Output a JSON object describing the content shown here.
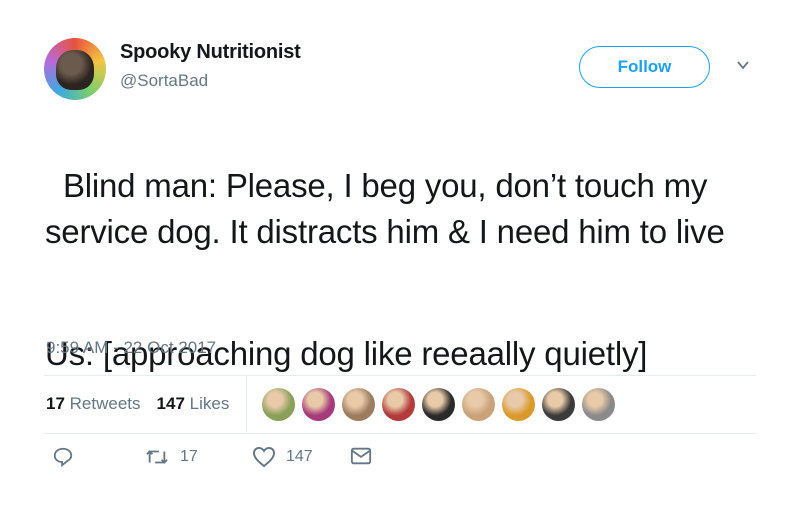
{
  "author": {
    "name": "Spooky Nutritionist",
    "handle": "@SortaBad"
  },
  "follow_label": "Follow",
  "tweet": {
    "line1": "Blind man: Please, I beg you, don’t touch my service dog. It distracts him & I need him to live",
    "line2": "Us: [approaching dog like reeaally quietly]"
  },
  "timestamp": "9:59 AM - 22 Oct 2017",
  "stats": {
    "retweets_count": "17",
    "retweets_label": "Retweets",
    "likes_count": "147",
    "likes_label": "Likes"
  },
  "likers": [
    {
      "color": "#8aa05a"
    },
    {
      "color": "#a63a7a"
    },
    {
      "color": "#9c7b5e"
    },
    {
      "color": "#b33b3b"
    },
    {
      "color": "#2a2a2a"
    },
    {
      "color": "#c9a27a"
    },
    {
      "color": "#d99a2b"
    },
    {
      "color": "#3a3a3a"
    },
    {
      "color": "#8a8a8a"
    }
  ],
  "actions": {
    "retweet_count": "17",
    "like_count": "147"
  },
  "colors": {
    "accent": "#1da1f2",
    "muted": "#657786",
    "text": "#14171a"
  }
}
